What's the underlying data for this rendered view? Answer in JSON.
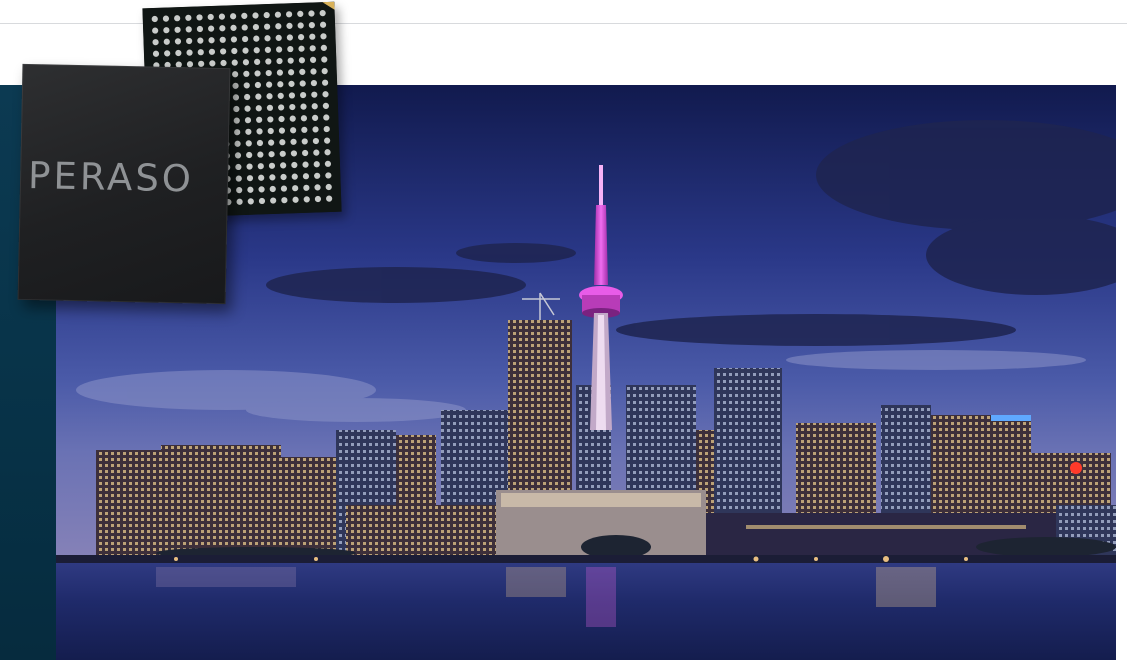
{
  "page": {
    "background": "#ffffff",
    "side_panel_color": "#073247"
  },
  "hero_image": {
    "description_name": "toronto-skyline-night",
    "sky_colors": [
      "#1a2466",
      "#3b4ea0",
      "#5867b8"
    ],
    "tower_light_color": "#d24fd6"
  },
  "chip": {
    "brand": "PERASO",
    "body_color": "#1f2022",
    "ball_color": "#c9ccca"
  }
}
